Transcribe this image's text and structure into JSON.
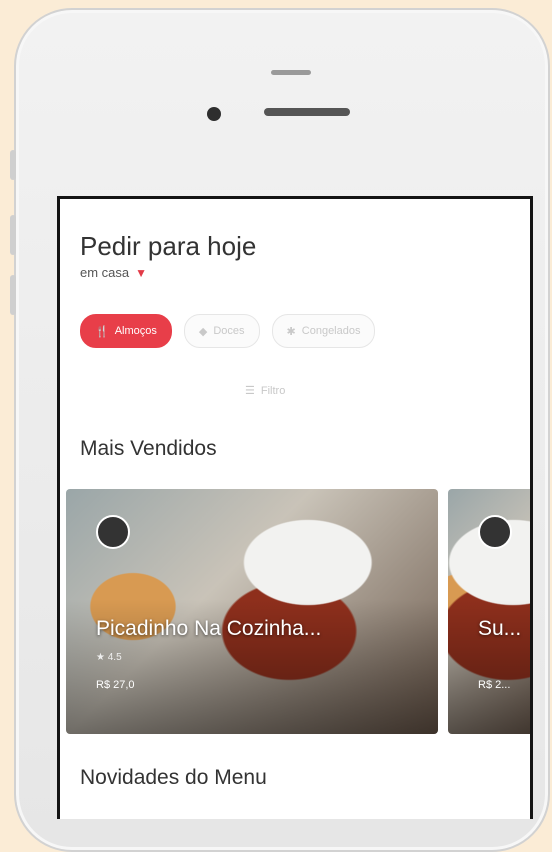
{
  "header": {
    "title": "Pedir para hoje",
    "location": "em casa"
  },
  "categories": [
    {
      "label": "Almoços",
      "icon": "fork-icon",
      "active": true
    },
    {
      "label": "Doces",
      "icon": "cake-icon",
      "active": false
    },
    {
      "label": "Congelados",
      "icon": "snowflake-icon",
      "active": false
    }
  ],
  "filter": {
    "label": "Filtro"
  },
  "sections": {
    "best_sellers": "Mais Vendidos",
    "new_items": "Novidades do Menu"
  },
  "cards": [
    {
      "title": "Picadinho Na Cozinha...",
      "meta": "★ 4.5",
      "price": "R$ 27,0"
    },
    {
      "title": "Su...",
      "meta": "",
      "price": "R$ 2..."
    }
  ],
  "colors": {
    "accent": "#e83e49",
    "background": "#fbecd6"
  }
}
